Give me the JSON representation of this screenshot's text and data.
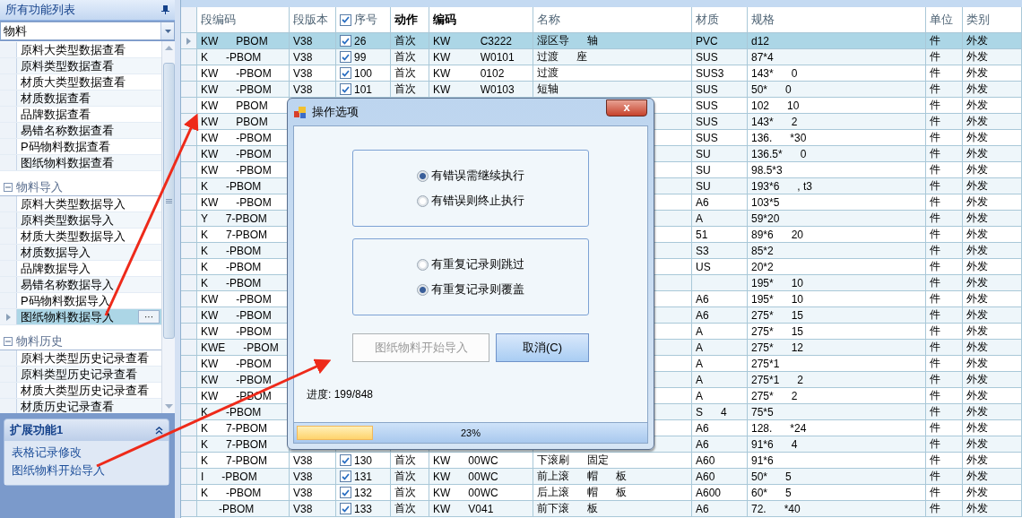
{
  "sidebar": {
    "title": "所有功能列表",
    "filter": {
      "value": "物料"
    },
    "groups": [
      {
        "items": [
          {
            "label": "原料大类型数据查看",
            "selected": false
          },
          {
            "label": "原料类型数据查看",
            "selected": false
          },
          {
            "label": "材质大类型数据查看",
            "selected": false
          },
          {
            "label": "材质数据查看",
            "selected": false
          },
          {
            "label": "品牌数据查看",
            "selected": false
          },
          {
            "label": "易错名称数据查看",
            "selected": false
          },
          {
            "label": "P码物料数据查看",
            "selected": false
          },
          {
            "label": "图纸物料数据查看",
            "selected": false
          }
        ]
      },
      {
        "label": "物料导入",
        "expanded": true,
        "items": [
          {
            "label": "原料大类型数据导入",
            "selected": false
          },
          {
            "label": "原料类型数据导入",
            "selected": false
          },
          {
            "label": "材质大类型数据导入",
            "selected": false
          },
          {
            "label": "材质数据导入",
            "selected": false
          },
          {
            "label": "品牌数据导入",
            "selected": false
          },
          {
            "label": "易错名称数据导入",
            "selected": false
          },
          {
            "label": "P码物料数据导入",
            "selected": false
          },
          {
            "label": "图纸物料数据导入",
            "selected": true,
            "more": "···"
          }
        ]
      },
      {
        "label": "物料历史",
        "expanded": true,
        "items": [
          {
            "label": "原料大类型历史记录查看",
            "selected": false
          },
          {
            "label": "原料类型历史记录查看",
            "selected": false
          },
          {
            "label": "材质大类型历史记录查看",
            "selected": false
          },
          {
            "label": "材质历史记录查看",
            "selected": false
          }
        ]
      }
    ]
  },
  "extension": {
    "title": "扩展功能1",
    "expanded": true,
    "links": [
      "表格记录修改",
      "图纸物料开始导入"
    ]
  },
  "table": {
    "header_checked": true,
    "columns": [
      {
        "label": "段编码",
        "bold": false
      },
      {
        "label": "段版本",
        "bold": false
      },
      {
        "label": "序号",
        "bold": false
      },
      {
        "label": "动作",
        "bold": true
      },
      {
        "label": "编码",
        "bold": true
      },
      {
        "label": "名称",
        "bold": false
      },
      {
        "label": "材质",
        "bold": false
      },
      {
        "label": "规格",
        "bold": false
      },
      {
        "label": "单位",
        "bold": false
      },
      {
        "label": "类别",
        "bold": false
      }
    ],
    "rows": [
      {
        "selected": true,
        "checked": true,
        "cells": [
          "KW      PBOM",
          "V38",
          "26",
          "首次",
          "KW          C3222",
          "湿区导      轴",
          "PVC",
          "d12",
          "件",
          "外发"
        ]
      },
      {
        "selected": false,
        "checked": true,
        "cells": [
          "K      -PBOM",
          "V38",
          "99",
          "首次",
          "KW          W0101",
          "过渡      座",
          "SUS",
          "87*4",
          "件",
          "外发"
        ]
      },
      {
        "selected": false,
        "checked": true,
        "cells": [
          "KW      -PBOM",
          "V38",
          "100",
          "首次",
          "KW          0102",
          "过渡",
          "SUS3",
          "143*      0",
          "件",
          "外发"
        ]
      },
      {
        "selected": false,
        "checked": true,
        "cells": [
          "KW      -PBOM",
          "V38",
          "101",
          "首次",
          "KW          W0103",
          "短轴",
          "SUS",
          "50*      0",
          "件",
          "外发"
        ]
      },
      {
        "selected": false,
        "cells": [
          "KW      PBOM",
          "",
          "",
          "",
          "",
          "",
          "SUS",
          "102      10",
          "件",
          "外发"
        ]
      },
      {
        "selected": false,
        "cells": [
          "KW      PBOM",
          "",
          "",
          "",
          "",
          "",
          "SUS",
          "143*      2",
          "件",
          "外发"
        ]
      },
      {
        "selected": false,
        "cells": [
          "KW      -PBOM",
          "",
          "",
          "",
          "",
          "",
          "SUS",
          "136.      *30",
          "件",
          "外发"
        ]
      },
      {
        "selected": false,
        "cells": [
          "KW      -PBOM",
          "",
          "",
          "",
          "",
          "",
          "SU",
          "136.5*      0",
          "件",
          "外发"
        ]
      },
      {
        "selected": false,
        "cells": [
          "KW      -PBOM",
          "",
          "",
          "",
          "",
          "",
          "SU",
          "98.5*3",
          "件",
          "外发"
        ]
      },
      {
        "selected": false,
        "cells": [
          "K      -PBOM",
          "",
          "",
          "",
          "",
          "",
          "SU",
          "193*6      , t3",
          "件",
          "外发"
        ]
      },
      {
        "selected": false,
        "cells": [
          "KW      -PBOM",
          "",
          "",
          "",
          "",
          "",
          "A6",
          "103*5",
          "件",
          "外发"
        ]
      },
      {
        "selected": false,
        "cells": [
          "Y      7-PBOM",
          "",
          "",
          "",
          "",
          "",
          "A",
          "59*20",
          "件",
          "外发"
        ]
      },
      {
        "selected": false,
        "cells": [
          "K      7-PBOM",
          "",
          "",
          "",
          "",
          "",
          "51",
          "89*6      20",
          "件",
          "外发"
        ]
      },
      {
        "selected": false,
        "cells": [
          "K      -PBOM",
          "",
          "",
          "",
          "",
          "",
          "S3",
          "85*2",
          "件",
          "外发"
        ]
      },
      {
        "selected": false,
        "cells": [
          "K      -PBOM",
          "",
          "",
          "",
          "",
          "",
          "US",
          "20*2",
          "件",
          "外发"
        ]
      },
      {
        "selected": false,
        "cells": [
          "K      -PBOM",
          "",
          "",
          "",
          "",
          "",
          "",
          "195*      10",
          "件",
          "外发"
        ]
      },
      {
        "selected": false,
        "cells": [
          "KW      -PBOM",
          "",
          "",
          "",
          "",
          "",
          "A6",
          "195*      10",
          "件",
          "外发"
        ]
      },
      {
        "selected": false,
        "cells": [
          "KW      -PBOM",
          "",
          "",
          "",
          "",
          "",
          "A6",
          "275*      15",
          "件",
          "外发"
        ]
      },
      {
        "selected": false,
        "cells": [
          "KW      -PBOM",
          "",
          "",
          "",
          "",
          "",
          "A",
          "275*      15",
          "件",
          "外发"
        ]
      },
      {
        "selected": false,
        "cells": [
          "KWE      -PBOM",
          "",
          "",
          "",
          "",
          "",
          "A",
          "275*      12",
          "件",
          "外发"
        ]
      },
      {
        "selected": false,
        "cells": [
          "KW      -PBOM",
          "",
          "",
          "",
          "",
          "",
          "A",
          "275*1",
          "件",
          "外发"
        ]
      },
      {
        "selected": false,
        "cells": [
          "KW      -PBOM",
          "",
          "",
          "",
          "",
          "",
          "A",
          "275*1      2",
          "件",
          "外发"
        ]
      },
      {
        "selected": false,
        "cells": [
          "KW      -PBOM",
          "",
          "",
          "",
          "",
          "",
          "A",
          "275*      2",
          "件",
          "外发"
        ]
      },
      {
        "selected": false,
        "cells": [
          "K      -PBOM",
          "",
          "",
          "",
          "",
          "",
          "S      4",
          "75*5",
          "件",
          "外发"
        ]
      },
      {
        "selected": false,
        "cells": [
          "K      7-PBOM",
          "",
          "",
          "",
          "",
          "",
          "A6",
          "128.      *24",
          "件",
          "外发"
        ]
      },
      {
        "selected": false,
        "cells": [
          "K      7-PBOM",
          "",
          "",
          "",
          "",
          "",
          "A6",
          "91*6      4",
          "件",
          "外发"
        ]
      },
      {
        "selected": false,
        "checked": true,
        "cells": [
          "K      7-PBOM",
          "V38",
          "130",
          "首次",
          "KW      00WC",
          "下滚刷      固定",
          "A60",
          "91*6",
          "件",
          "外发"
        ]
      },
      {
        "selected": false,
        "checked": true,
        "cells": [
          "I      -PBOM",
          "V38",
          "131",
          "首次",
          "KW      00WC",
          "前上滚      帽      板",
          "A60",
          "50*      5",
          "件",
          "外发"
        ]
      },
      {
        "selected": false,
        "checked": true,
        "cells": [
          "K      -PBOM",
          "V38",
          "132",
          "首次",
          "KW      00WC",
          "后上滚      帽      板",
          "A600",
          "60*      5",
          "件",
          "外发"
        ]
      },
      {
        "selected": false,
        "checked": true,
        "cells": [
          "      -PBOM",
          "V38",
          "133",
          "首次",
          "KW      V041",
          "前下滚      板",
          "A6",
          "72.      *40",
          "件",
          "外发"
        ]
      }
    ]
  },
  "dialog": {
    "title": "操作选项",
    "close": "x",
    "option_groups": [
      [
        {
          "label": "有错误需继续执行",
          "selected": true
        },
        {
          "label": "有错误则终止执行",
          "selected": false
        }
      ],
      [
        {
          "label": "有重复记录则跳过",
          "selected": false
        },
        {
          "label": "有重复记录则覆盖",
          "selected": true
        }
      ]
    ],
    "buttons": [
      {
        "label": "图纸物料开始导入",
        "disabled": true
      },
      {
        "label": "取消(C)",
        "disabled": false
      }
    ],
    "progress_text": "进度: 199/848",
    "progress": {
      "level": 0.23,
      "reading": "23%"
    }
  }
}
